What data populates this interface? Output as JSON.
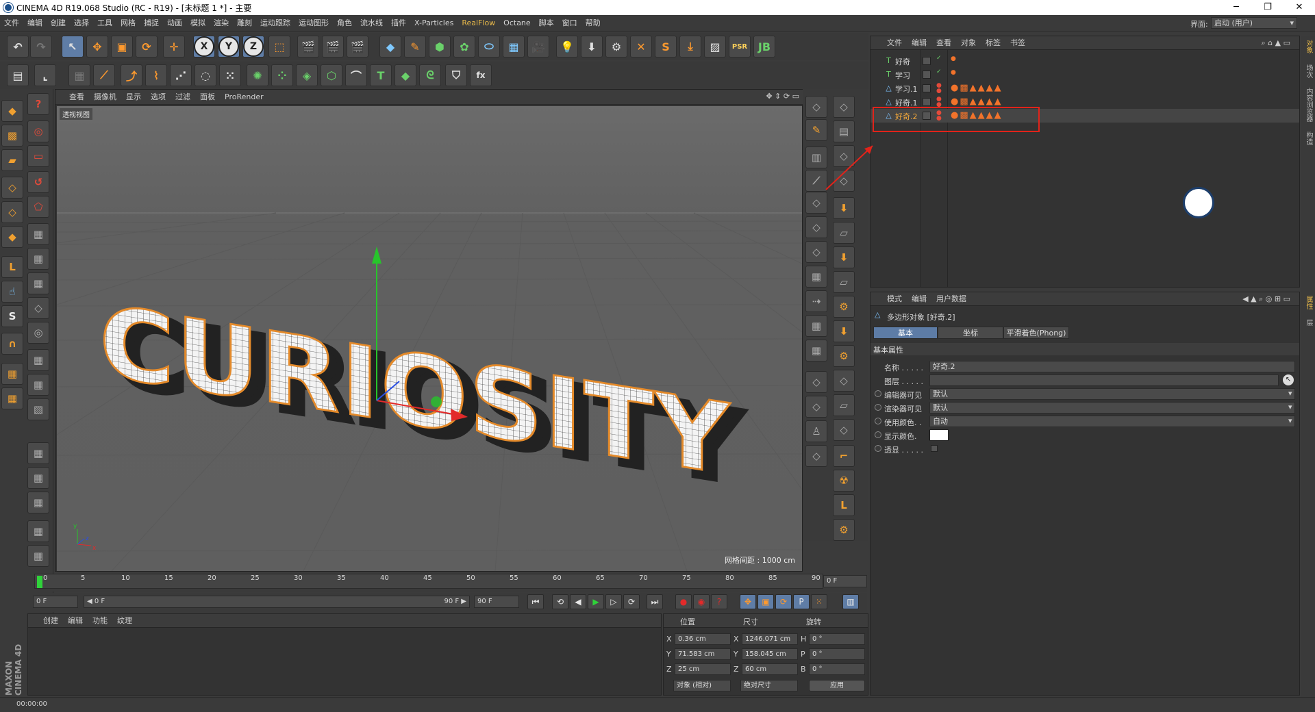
{
  "window": {
    "title": "CINEMA 4D R19.068 Studio (RC - R19) - [未标题 1 *] - 主要"
  },
  "menu": [
    "文件",
    "编辑",
    "创建",
    "选择",
    "工具",
    "网格",
    "捕捉",
    "动画",
    "模拟",
    "渲染",
    "雕刻",
    "运动跟踪",
    "运动图形",
    "角色",
    "流水线",
    "插件",
    "X-Particles",
    "RealFlow",
    "Octane",
    "脚本",
    "窗口",
    "帮助"
  ],
  "layout": {
    "label": "界面:",
    "value": "启动 (用户)"
  },
  "viewport": {
    "menu": [
      "查看",
      "摄像机",
      "显示",
      "选项",
      "过滤",
      "面板",
      "ProRender"
    ],
    "view_label": "透视视图",
    "grid_info": "网格间距 : 1000 cm",
    "scene_text": "CURIOSITY",
    "axis_x": "x",
    "axis_y": "y",
    "axis_z": "z"
  },
  "object_manager": {
    "menu": [
      "文件",
      "编辑",
      "查看",
      "对象",
      "标签",
      "书签"
    ],
    "objects": [
      {
        "name": "好奇",
        "icon": "T",
        "selected": false
      },
      {
        "name": "学习",
        "icon": "T",
        "selected": false
      },
      {
        "name": "学习.1",
        "icon": "△",
        "selected": false
      },
      {
        "name": "好奇.1",
        "icon": "△",
        "selected": false
      },
      {
        "name": "好奇.2",
        "icon": "△",
        "selected": true
      }
    ]
  },
  "attribute_manager": {
    "menu": [
      "模式",
      "编辑",
      "用户数据"
    ],
    "object_title": "多边形对象 [好奇.2]",
    "tabs": [
      "基本",
      "坐标",
      "平滑着色(Phong)"
    ],
    "section": "基本属性",
    "rows": [
      {
        "label": "名称 . . . . .",
        "value": "好奇.2"
      },
      {
        "label": "图层 . . . . .",
        "value": ""
      },
      {
        "label": "编辑器可见",
        "value": "默认"
      },
      {
        "label": "渲染器可见",
        "value": "默认"
      },
      {
        "label": "使用颜色. .",
        "value": "自动"
      },
      {
        "label": "显示颜色.",
        "value": ""
      },
      {
        "label": "透显 . . . . .",
        "value": ""
      }
    ]
  },
  "timeline": {
    "ticks": [
      "0",
      "5",
      "10",
      "15",
      "20",
      "25",
      "30",
      "35",
      "40",
      "45",
      "50",
      "55",
      "60",
      "65",
      "70",
      "75",
      "80",
      "85",
      "90"
    ],
    "end_field": "0 F",
    "current_frame": "0 F",
    "range_start": "◀ 0 F",
    "range_end": "90 F ▶",
    "max_frame": "90 F"
  },
  "material_manager": {
    "menu": [
      "创建",
      "编辑",
      "功能",
      "纹理"
    ]
  },
  "brand": "MAXON CINEMA 4D",
  "coordinates": {
    "headers": [
      "位置",
      "尺寸",
      "旋转"
    ],
    "rows": [
      {
        "axis": "X",
        "pos": "0.36 cm",
        "size_axis": "X",
        "size": "1246.071 cm",
        "rot_axis": "H",
        "rot": "0 °"
      },
      {
        "axis": "Y",
        "pos": "71.583 cm",
        "size_axis": "Y",
        "size": "158.045 cm",
        "rot_axis": "P",
        "rot": "0 °"
      },
      {
        "axis": "Z",
        "pos": "25 cm",
        "size_axis": "Z",
        "size": "60 cm",
        "rot_axis": "B",
        "rot": "0 °"
      }
    ],
    "mode": "对象 (相对)",
    "size_mode": "绝对尺寸",
    "apply": "应用"
  },
  "status": {
    "time": "00:00:00"
  },
  "right_tabs": [
    "对象",
    "场次",
    "内容浏览器",
    "构造",
    "属性",
    "层"
  ],
  "colors": {
    "accent": "#5d7ca6",
    "highlight": "#e2231a",
    "menu_highlight": "#e8b94a"
  }
}
